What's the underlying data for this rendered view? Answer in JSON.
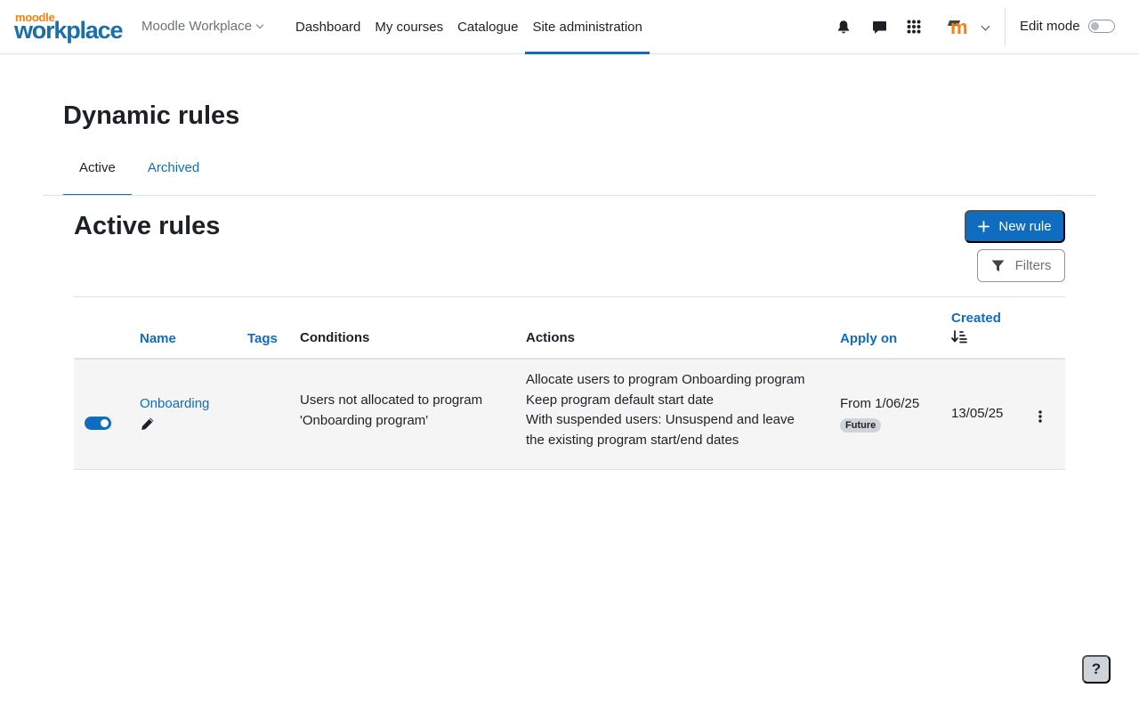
{
  "brand": {
    "logo_top": "moodle",
    "logo_bottom": "workplace"
  },
  "navbar": {
    "site_selector": "Moodle Workplace",
    "links": [
      "Dashboard",
      "My courses",
      "Catalogue",
      "Site administration"
    ],
    "active_link": "Site administration",
    "edit_mode_label": "Edit mode",
    "user_initial": "m"
  },
  "page": {
    "title": "Dynamic rules",
    "tabs": [
      {
        "label": "Active",
        "active": true
      },
      {
        "label": "Archived",
        "active": false
      }
    ]
  },
  "section": {
    "title": "Active rules",
    "new_button": "New rule",
    "filters_button": "Filters"
  },
  "table": {
    "headers": {
      "name": "Name",
      "tags": "Tags",
      "conditions": "Conditions",
      "actions": "Actions",
      "apply_on": "Apply on",
      "created": "Created"
    },
    "rows": [
      {
        "enabled": true,
        "name": "Onboarding",
        "tags": "",
        "conditions": [
          "Users not allocated to program",
          "'Onboarding program'"
        ],
        "actions": [
          "Allocate users to program Onboarding program",
          "Keep program default start date",
          "With suspended users: Unsuspend and leave",
          "the existing program start/end dates"
        ],
        "apply_on": "From 1/06/25",
        "apply_badge": "Future",
        "created": "13/05/25"
      }
    ]
  },
  "help_label": "?",
  "colors": {
    "primary": "#0f6cbf",
    "brand_orange": "#f98012",
    "brand_blue": "#1a6fa9"
  }
}
